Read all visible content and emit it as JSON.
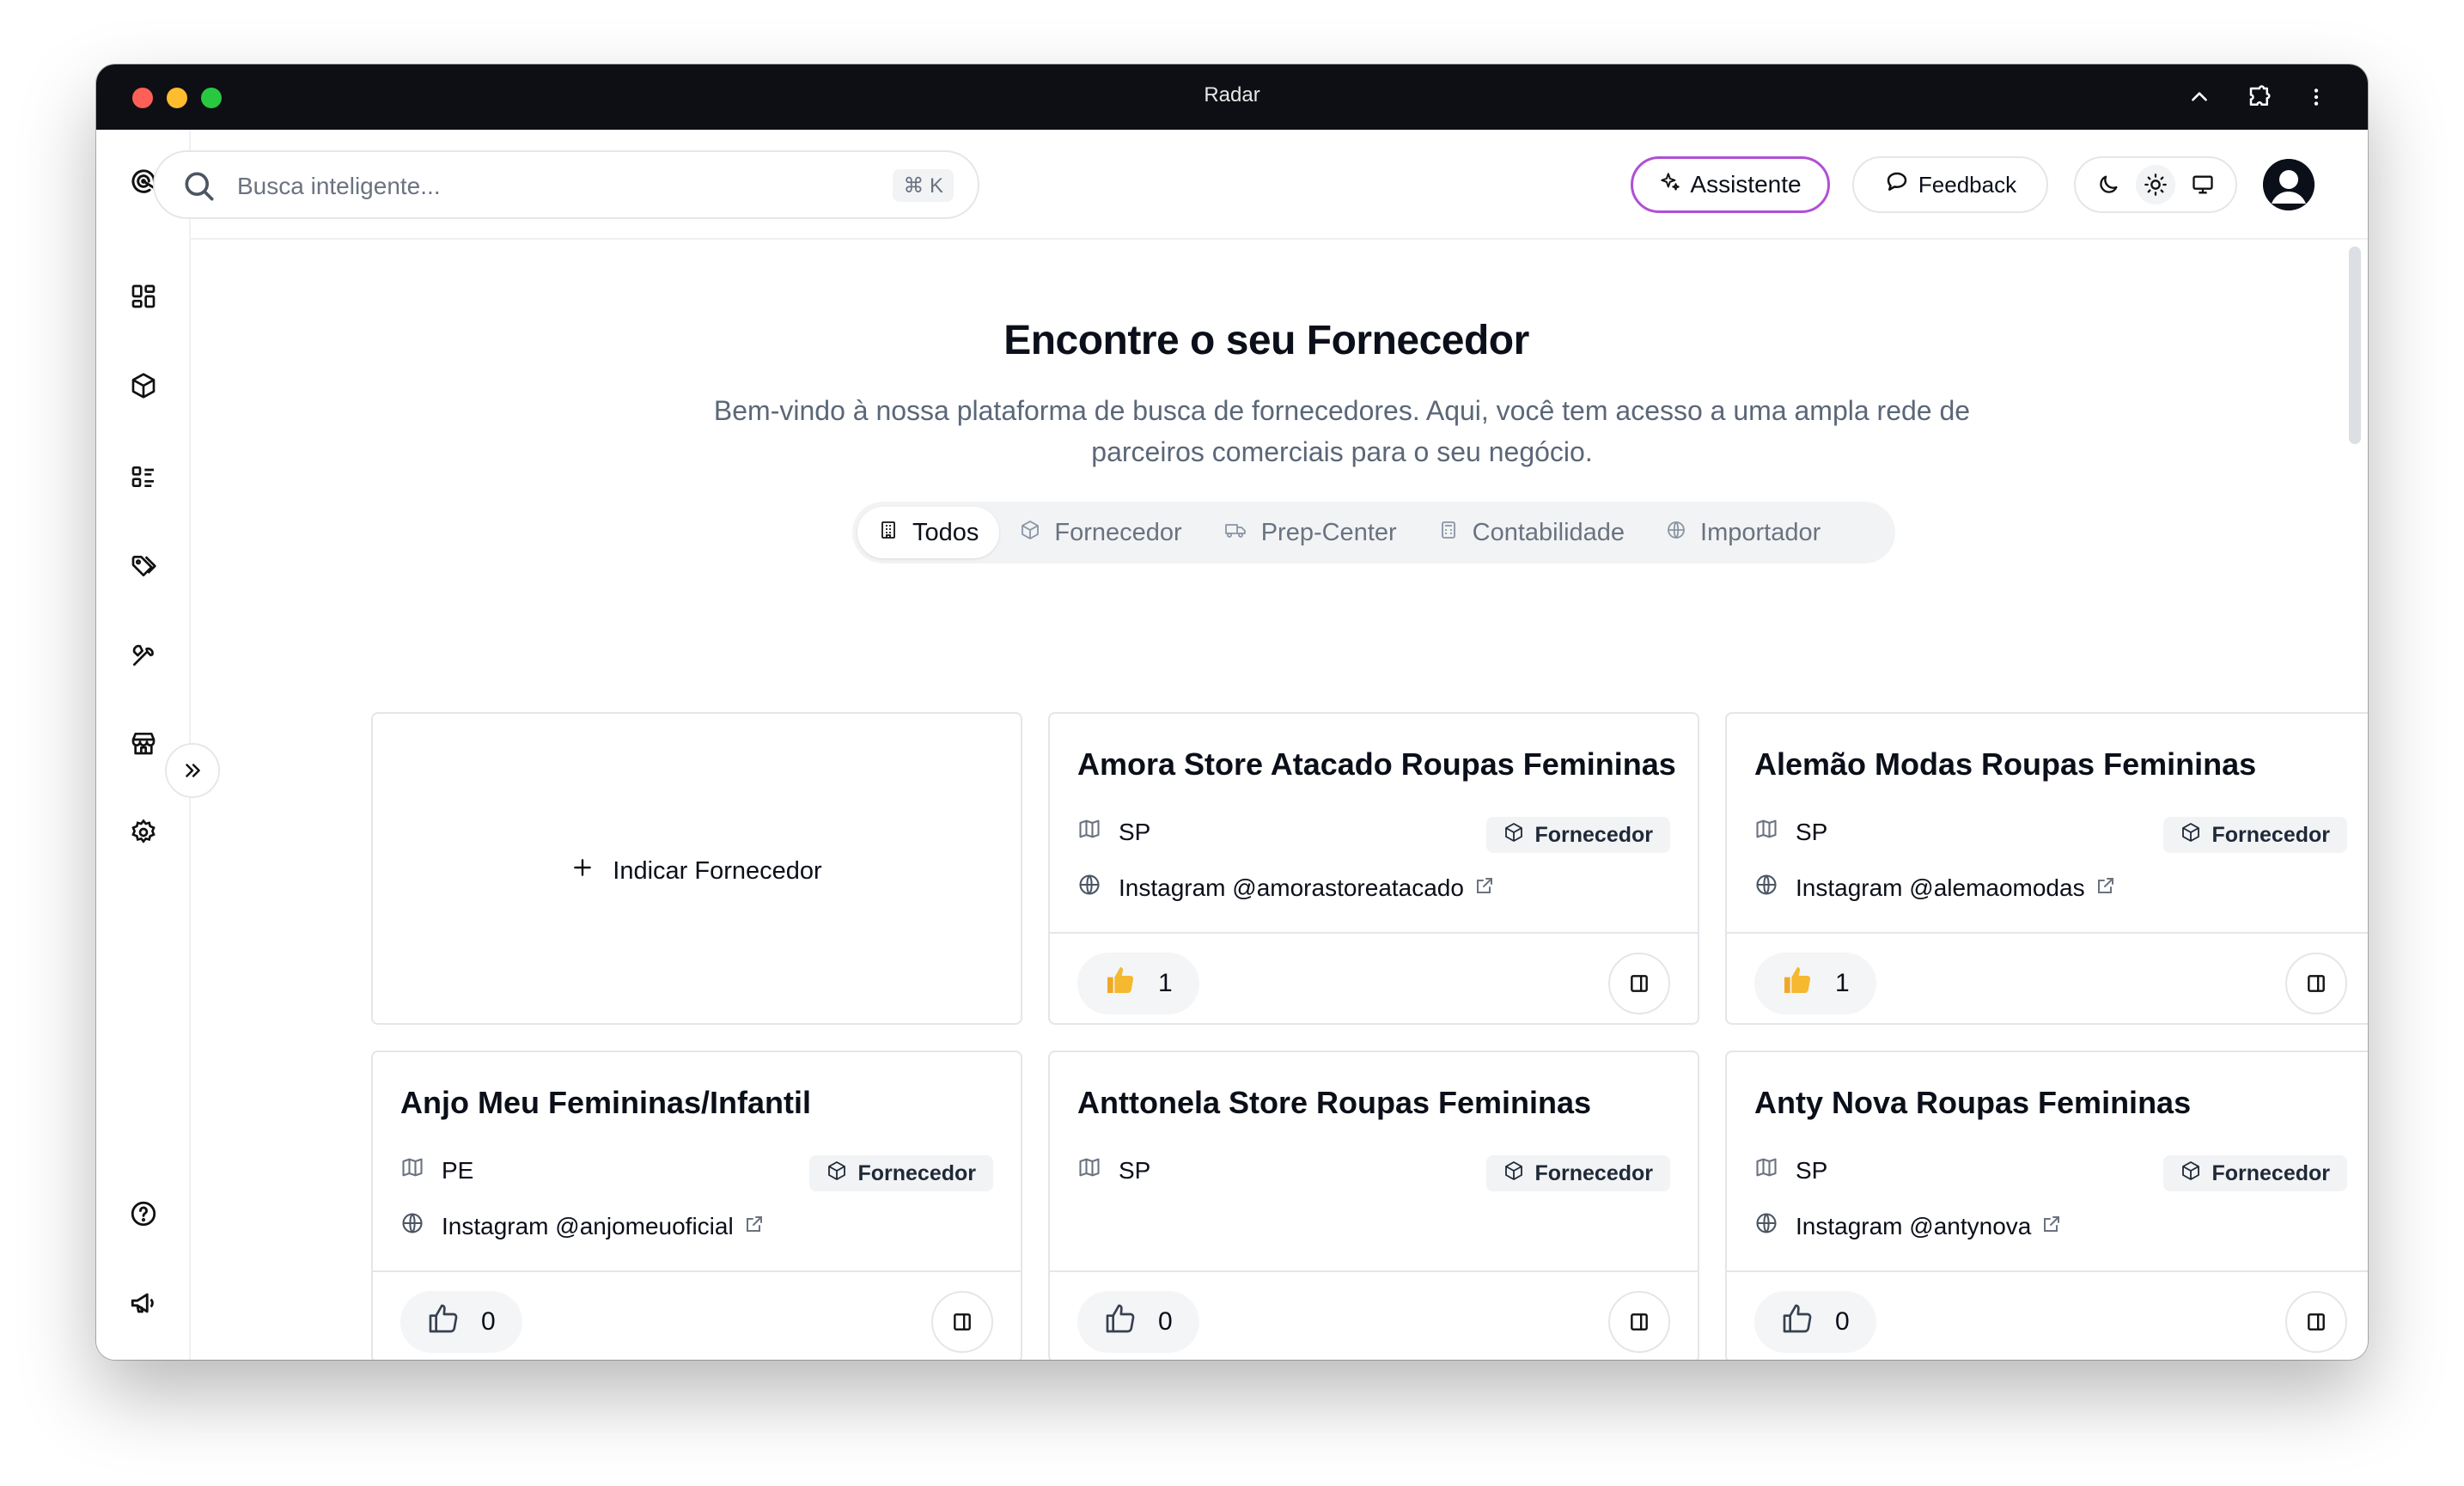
{
  "window": {
    "title": "Radar"
  },
  "search": {
    "placeholder": "Busca inteligente...",
    "shortcut": "⌘ K"
  },
  "header": {
    "assistant_label": "Assistente",
    "feedback_label": "Feedback"
  },
  "page": {
    "title": "Encontre o seu Fornecedor",
    "subtitle_line1": "Bem-vindo à nossa plataforma de busca de fornecedores. Aqui, você tem acesso a uma ampla rede de",
    "subtitle_line2": "parceiros comerciais para o seu negócio."
  },
  "filters": [
    {
      "label": "Todos",
      "icon": "building-icon",
      "active": true
    },
    {
      "label": "Fornecedor",
      "icon": "package-icon",
      "active": false
    },
    {
      "label": "Prep-Center",
      "icon": "truck-icon",
      "active": false
    },
    {
      "label": "Contabilidade",
      "icon": "calculator-icon",
      "active": false
    },
    {
      "label": "Importador",
      "icon": "globe-icon",
      "active": false
    }
  ],
  "add_card": {
    "label": "Indicar Fornecedor"
  },
  "suppliers": [
    {
      "name": "Amora Store Atacado Roupas Femininas",
      "state": "SP",
      "type": "Fornecedor",
      "link": "Instagram @amorastoreatacado",
      "likes": "1",
      "liked": true
    },
    {
      "name": "Alemão Modas Roupas Femininas",
      "state": "SP",
      "type": "Fornecedor",
      "link": "Instagram @alemaomodas",
      "likes": "1",
      "liked": true
    },
    {
      "name": "Anjo Meu Femininas/Infantil",
      "state": "PE",
      "type": "Fornecedor",
      "link": "Instagram @anjomeuoficial",
      "likes": "0",
      "liked": false
    },
    {
      "name": "Anttonela Store Roupas Femininas",
      "state": "SP",
      "type": "Fornecedor",
      "link": "",
      "likes": "0",
      "liked": false
    },
    {
      "name": "Anty Nova Roupas Femininas",
      "state": "SP",
      "type": "Fornecedor",
      "link": "Instagram @antynova",
      "likes": "0",
      "liked": false
    }
  ],
  "colors": {
    "accent_assistant": "#b14fd6",
    "like_active": "#f5b82e",
    "titlebar": "#0d0f14"
  }
}
